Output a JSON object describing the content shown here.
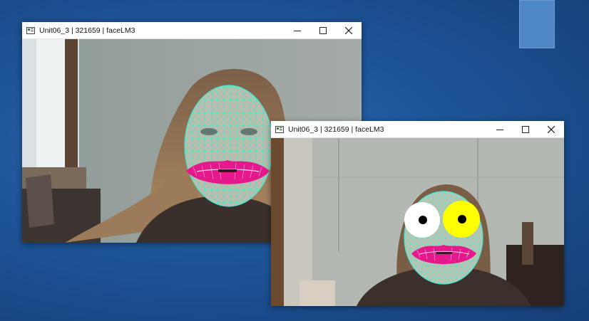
{
  "windows": [
    {
      "title": "Unit06_3 | 321659 | faceLM3",
      "overlay": "mesh-lips",
      "icons": [
        "app-icon",
        "minimize-icon",
        "maximize-icon",
        "close-icon"
      ]
    },
    {
      "title": "Unit06_3 | 321659 | faceLM3",
      "overlay": "mesh-lips-eyes",
      "icons": [
        "app-icon",
        "minimize-icon",
        "maximize-icon",
        "close-icon"
      ]
    }
  ],
  "colors": {
    "desktop": "#1d5497",
    "mesh": "#40e0d0",
    "lips": "#e6198c",
    "eye_left": "#ffffff",
    "eye_right": "#ffff00",
    "pupil": "#000000"
  }
}
